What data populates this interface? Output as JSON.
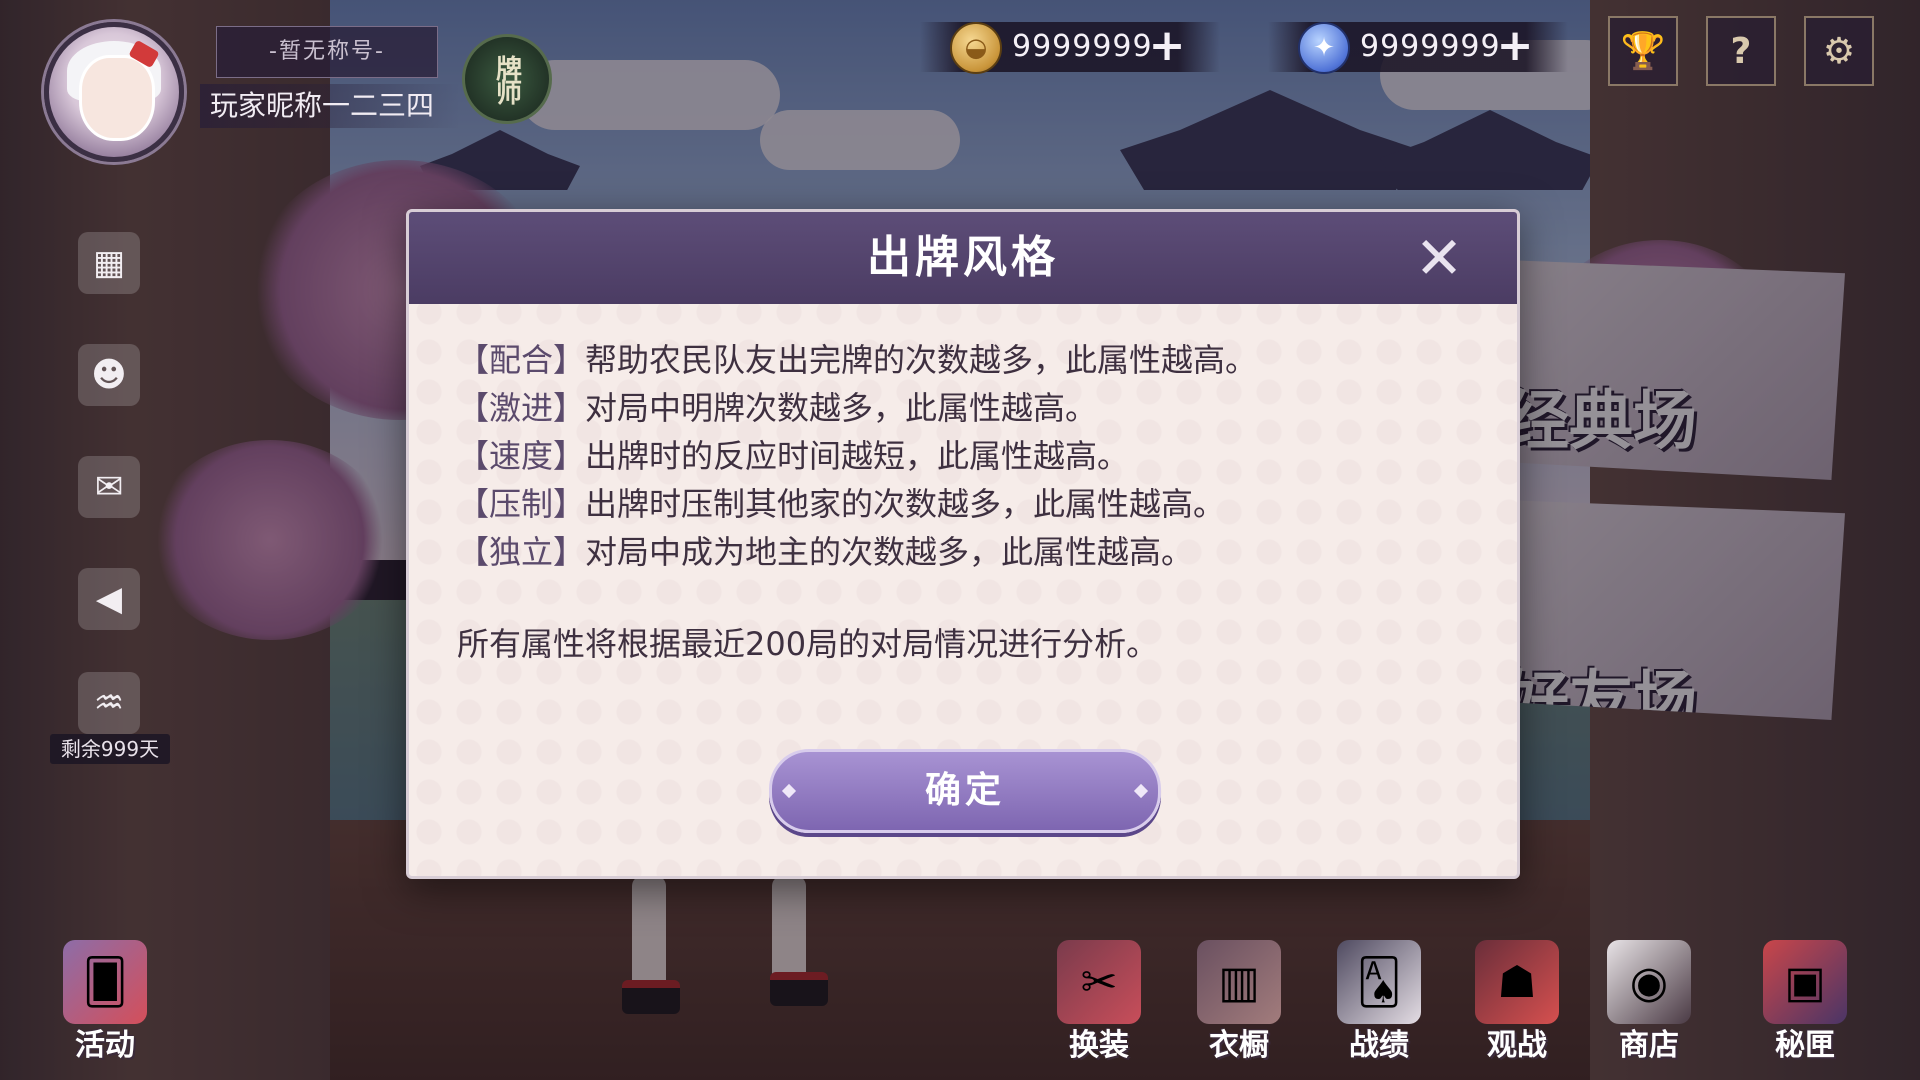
{
  "player": {
    "title": "-暂无称号-",
    "nickname": "玩家昵称一二三四",
    "rank_badge": "牌师"
  },
  "currencies": [
    {
      "icon": "coin-icon",
      "value": "9999999",
      "plus": "+"
    },
    {
      "icon": "gem-icon",
      "value": "9999999",
      "plus": "+"
    }
  ],
  "top_buttons": {
    "trophy": "🏆",
    "help": "?",
    "settings": "⚙"
  },
  "side": {
    "remain_days": "剩余999天"
  },
  "modes": {
    "classic": "经典场",
    "friends": "好友场"
  },
  "bottom_nav": [
    {
      "label": "活动",
      "icon": "activity-cards-icon"
    },
    {
      "label": "换装",
      "icon": "dress-up-icon"
    },
    {
      "label": "衣橱",
      "icon": "wardrobe-icon"
    },
    {
      "label": "战绩",
      "icon": "record-cards-icon"
    },
    {
      "label": "观战",
      "icon": "fox-mask-icon"
    },
    {
      "label": "商店",
      "icon": "panda-shop-icon"
    },
    {
      "label": "秘匣",
      "icon": "secret-box-icon"
    }
  ],
  "modal": {
    "title": "出牌风格",
    "close": "✕",
    "rules": [
      {
        "key": "【配合】",
        "text": "帮助农民队友出完牌的次数越多，此属性越高。"
      },
      {
        "key": "【激进】",
        "text": "对局中明牌次数越多，此属性越高。"
      },
      {
        "key": "【速度】",
        "text": "出牌时的反应时间越短，此属性越高。"
      },
      {
        "key": "【压制】",
        "text": "出牌时压制其他家的次数越多，此属性越高。"
      },
      {
        "key": "【独立】",
        "text": "对局中成为地主的次数越多，此属性越高。"
      }
    ],
    "analysis": "所有属性将根据最近200局的对局情况进行分析。",
    "confirm": "确定"
  },
  "colors": {
    "modal_header": "#4b3c63",
    "modal_body": "#f6ece9",
    "confirm_button": "#8f79c2"
  }
}
